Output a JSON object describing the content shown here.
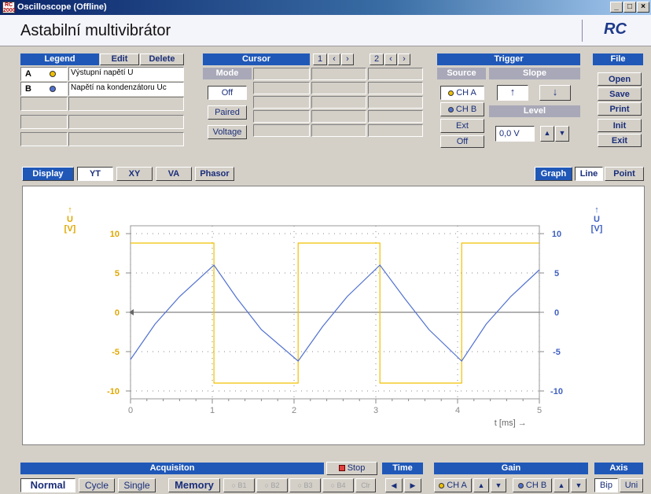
{
  "window": {
    "title": "Oscilloscope (Offline)",
    "icon_text": "RC 2000"
  },
  "header": {
    "title": "Astabilní multivibrátor",
    "brand": "RC"
  },
  "legend": {
    "heading": "Legend",
    "edit": "Edit",
    "delete": "Delete",
    "rows": [
      {
        "id": "A",
        "label": "Výstupní napětí  U",
        "color": "#f0c000"
      },
      {
        "id": "B",
        "label": "Napětí na kondenzátoru Uc",
        "color": "#5070d0"
      }
    ]
  },
  "cursor": {
    "heading": "Cursor",
    "mode_label": "Mode",
    "off": "Off",
    "paired": "Paired",
    "voltage": "Voltage",
    "c1": "1",
    "c2": "2"
  },
  "trigger": {
    "heading": "Trigger",
    "source_label": "Source",
    "slope_label": "Slope",
    "cha": "CH A",
    "chb": "CH B",
    "ext": "Ext",
    "off": "Off",
    "up": "↑",
    "down": "↓",
    "level_label": "Level",
    "level_value": "0,0 V"
  },
  "file": {
    "heading": "File",
    "open": "Open",
    "save": "Save",
    "print": "Print",
    "init": "Init",
    "exit": "Exit"
  },
  "display": {
    "label": "Display",
    "yt": "YT",
    "xy": "XY",
    "va": "VA",
    "phasor": "Phasor",
    "graph": "Graph",
    "line": "Line",
    "point": "Point"
  },
  "chart_data": {
    "type": "line",
    "xlabel": "t [ms]",
    "ylabel_left": "U\n[V]",
    "ylabel_right": "U\n[V]",
    "x_ticks": [
      "0",
      "1",
      "2",
      "3",
      "4",
      "5"
    ],
    "y_ticks": [
      "-10",
      "-5",
      "0",
      "5",
      "10"
    ],
    "xlim": [
      0,
      5
    ],
    "ylim": [
      -11,
      11
    ],
    "series": [
      {
        "name": "Výstupní napětí  U",
        "color": "#f0c000",
        "x": [
          0,
          1.02,
          1.02,
          2.05,
          2.05,
          3.05,
          3.05,
          4.05,
          4.05,
          5
        ],
        "y": [
          8.8,
          8.8,
          -9,
          -9,
          8.8,
          8.8,
          -9,
          -9,
          8.8,
          8.8
        ]
      },
      {
        "name": "Napětí na kondenzátoru Uc",
        "color": "#5070d0",
        "x": [
          0,
          0.3,
          0.6,
          1.02,
          1.3,
          1.6,
          2.05,
          2.35,
          2.65,
          3.05,
          3.35,
          3.65,
          4.05,
          4.35,
          4.65,
          5
        ],
        "y": [
          -6,
          -1.5,
          2,
          6,
          1.8,
          -2.2,
          -6.2,
          -1.8,
          2,
          6,
          1.8,
          -2.2,
          -6.2,
          -1.5,
          2,
          5.4
        ]
      }
    ]
  },
  "acq": {
    "heading": "Acquisiton",
    "stop": "Stop",
    "normal": "Normal",
    "cycle": "Cycle",
    "single": "Single",
    "memory": "Memory",
    "b1": "B1",
    "b2": "B2",
    "b3": "B3",
    "b4": "B4",
    "clr": "Clr"
  },
  "time": {
    "heading": "Time"
  },
  "gain": {
    "heading": "Gain",
    "cha": "CH A",
    "chb": "CH B"
  },
  "axis": {
    "heading": "Axis",
    "bip": "Bip",
    "uni": "Uni"
  }
}
